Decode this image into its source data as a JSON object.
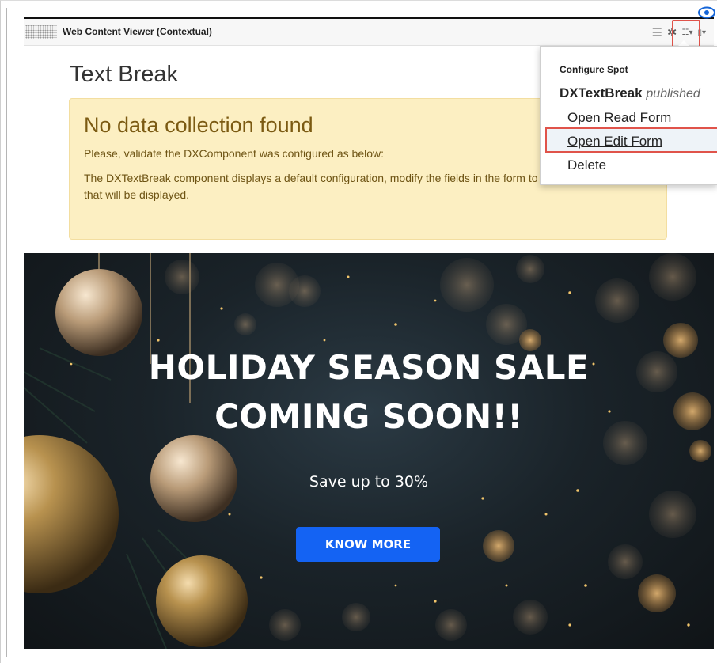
{
  "portlet": {
    "title": "Web Content Viewer (Contextual)",
    "icons": [
      "menu-icon",
      "gear-icon",
      "edit-mode-icon",
      "dropdown-icon",
      "eye-icon"
    ]
  },
  "content": {
    "page_title": "Text Break",
    "alert": {
      "title": "No data collection found",
      "line1": "Please, validate the DXComponent was configured as below:",
      "line2": "The DXTextBreak component displays a default configuration, modify the fields in the form to customize the content that will be displayed."
    }
  },
  "banner": {
    "headline1": "HOLIDAY SEASON SALE",
    "headline2": "COMING SOON!!",
    "subtitle": "Save up to 30%",
    "button_label": "KNOW MORE"
  },
  "menu": {
    "heading": "Configure Spot",
    "component_name": "DXTextBreak",
    "component_status": "published",
    "items": [
      "Open Read Form",
      "Open Edit Form",
      "Delete"
    ]
  },
  "colors": {
    "alert_bg": "#fcefc2",
    "alert_text": "#7b5a12",
    "button_blue": "#1463f3",
    "highlight_red": "#e0534a"
  }
}
